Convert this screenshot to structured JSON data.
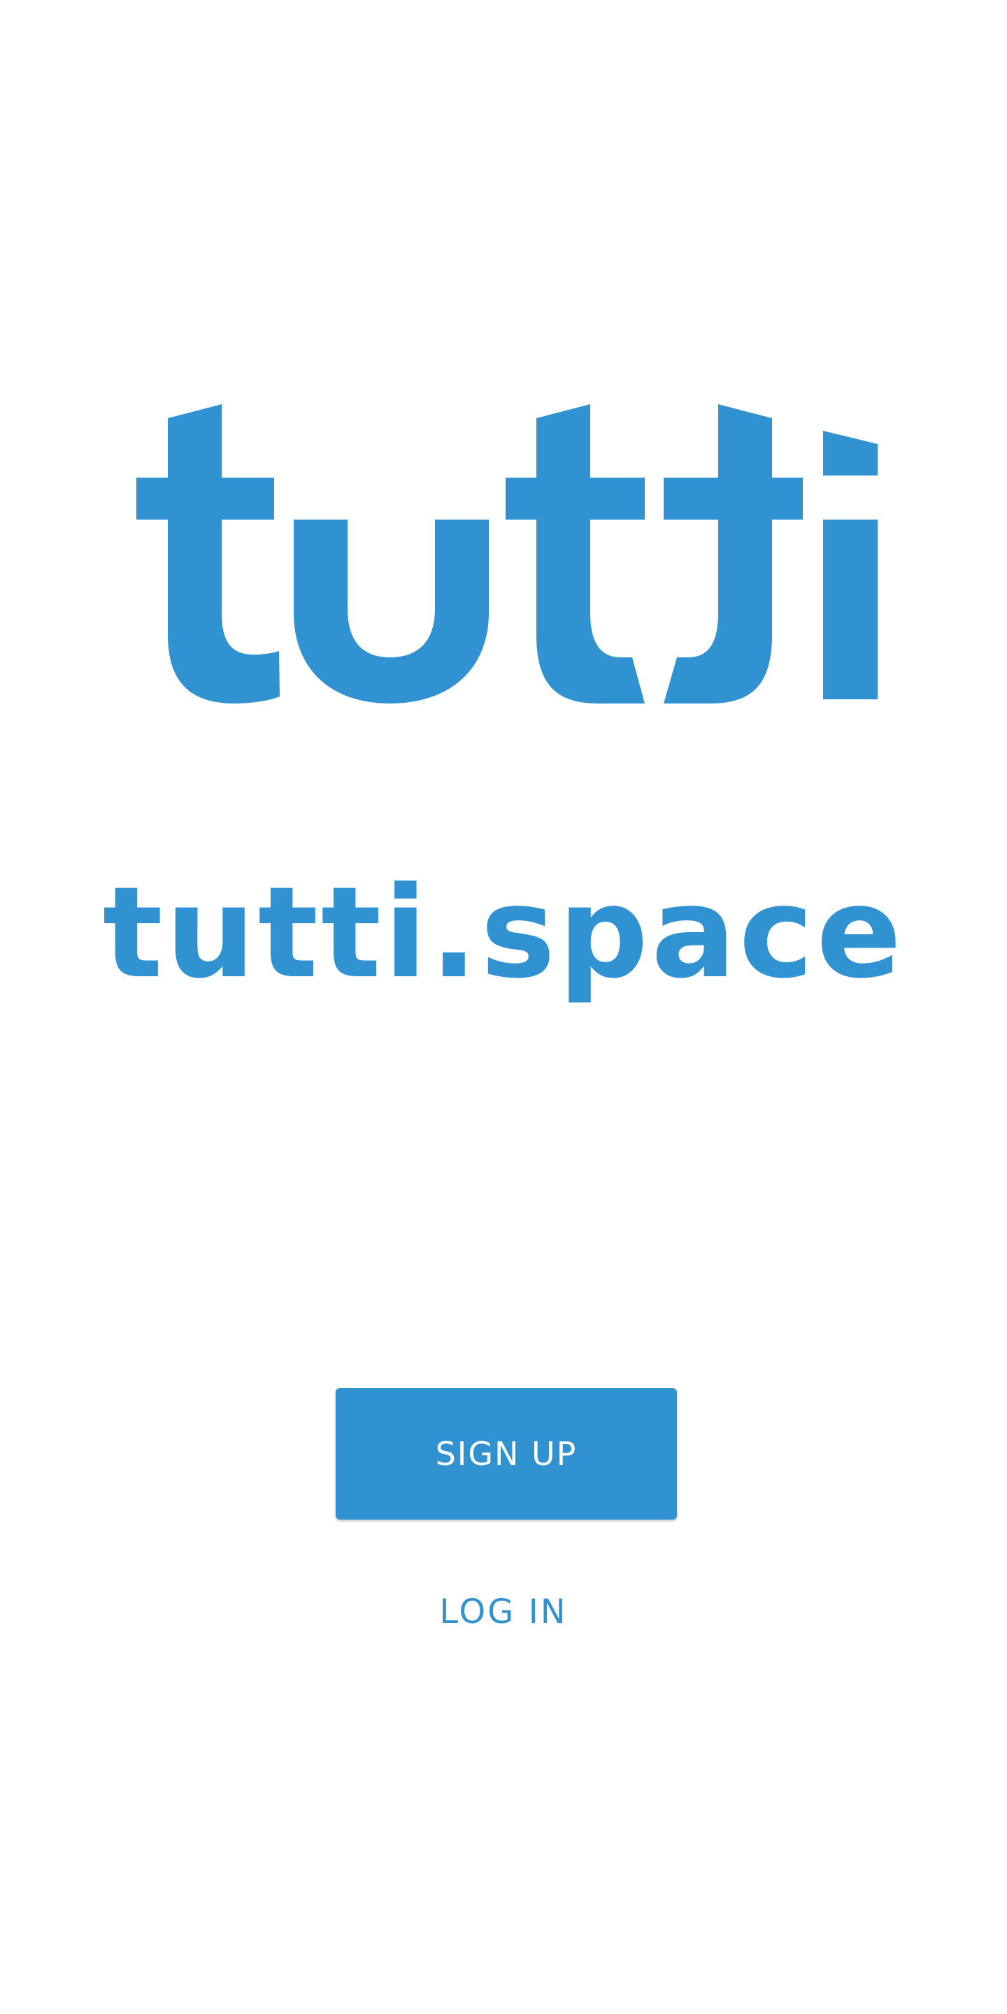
{
  "theme": {
    "brand_color": "#3092d1",
    "background_color": "#ffffff",
    "button_text_color": "#ffffff"
  },
  "logo": {
    "wordmark": "tutti",
    "icon": "tutti-logo-icon"
  },
  "domain": {
    "text": "tutti.space"
  },
  "actions": {
    "signup_label": "SIGN UP",
    "login_label": "LOG IN"
  }
}
